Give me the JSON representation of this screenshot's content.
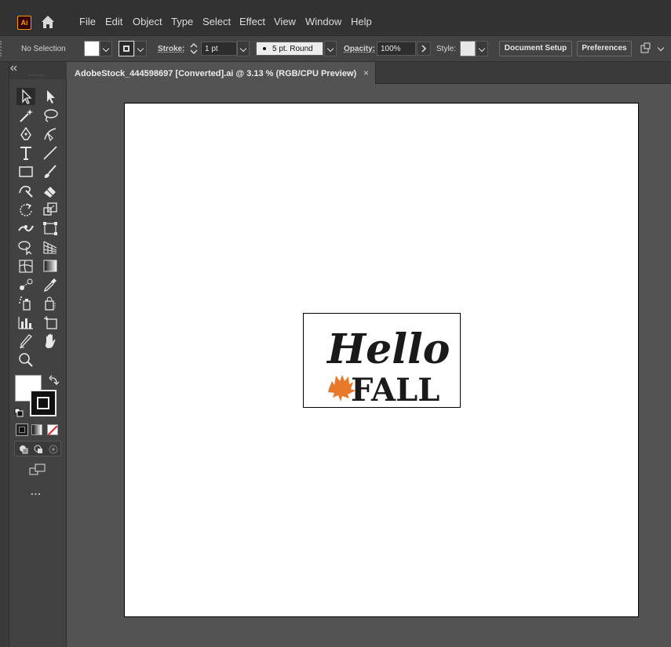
{
  "app": {
    "logo_text": "Ai",
    "menu": [
      "File",
      "Edit",
      "Object",
      "Type",
      "Select",
      "Effect",
      "View",
      "Window",
      "Help"
    ]
  },
  "control_bar": {
    "selection_label": "No Selection",
    "stroke_label": "Stroke:",
    "stroke_value": "1 pt",
    "brush_value": "5 pt. Round",
    "opacity_label": "Opacity:",
    "opacity_value": "100%",
    "style_label": "Style:",
    "document_setup": "Document Setup",
    "preferences": "Preferences",
    "fill_color": "#ffffff"
  },
  "document": {
    "tab_title": "AdobeStock_444598697 [Converted].ai @ 3.13 % (RGB/CPU Preview)",
    "close_glyph": "×"
  },
  "artwork": {
    "line1": "Hello",
    "line2": "FALL",
    "leaf_color": "#e8782a",
    "text_color": "#1a1a1a"
  },
  "toolbar": {
    "more_label": "..."
  }
}
